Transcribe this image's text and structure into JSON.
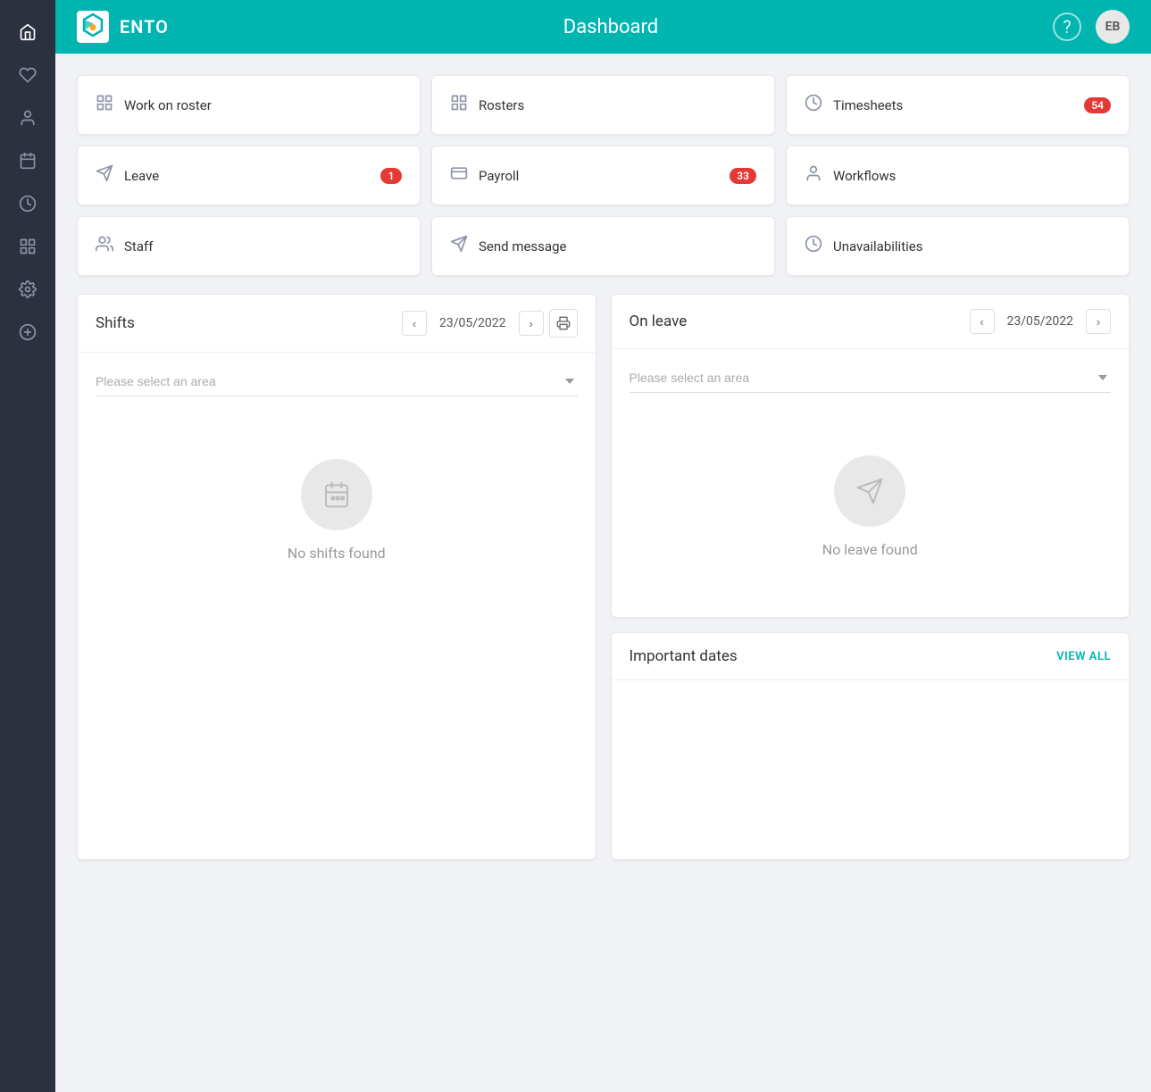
{
  "sidebar": {
    "icons": [
      {
        "name": "home-icon",
        "symbol": "⌂"
      },
      {
        "name": "heart-icon",
        "symbol": "♡"
      },
      {
        "name": "person-icon",
        "symbol": "👤"
      },
      {
        "name": "calendar-icon",
        "symbol": "▦"
      },
      {
        "name": "clock-icon",
        "symbol": "🕐"
      },
      {
        "name": "grid-icon",
        "symbol": "⊞"
      },
      {
        "name": "settings-icon",
        "symbol": "⚙"
      },
      {
        "name": "add-circle-icon",
        "symbol": "⊕"
      }
    ]
  },
  "header": {
    "title": "Dashboard",
    "help_label": "?",
    "avatar_initials": "EB"
  },
  "quick_links": [
    {
      "id": "work-on-roster",
      "label": "Work on roster",
      "badge": null,
      "icon": "roster-icon"
    },
    {
      "id": "rosters",
      "label": "Rosters",
      "badge": null,
      "icon": "roster-icon"
    },
    {
      "id": "timesheets",
      "label": "Timesheets",
      "badge": "54",
      "icon": "clock-icon"
    },
    {
      "id": "leave",
      "label": "Leave",
      "badge": "1",
      "icon": "leave-icon"
    },
    {
      "id": "payroll",
      "label": "Payroll",
      "badge": "33",
      "icon": "payroll-icon"
    },
    {
      "id": "workflows",
      "label": "Workflows",
      "badge": null,
      "icon": "workflows-icon"
    },
    {
      "id": "staff",
      "label": "Staff",
      "badge": null,
      "icon": "staff-icon"
    },
    {
      "id": "send-message",
      "label": "Send message",
      "badge": null,
      "icon": "message-icon"
    },
    {
      "id": "unavailabilities",
      "label": "Unavailabilities",
      "badge": null,
      "icon": "unavail-icon"
    }
  ],
  "shifts_panel": {
    "title": "Shifts",
    "date": "23/05/2022",
    "area_placeholder": "Please select an area",
    "empty_text": "No shifts found"
  },
  "on_leave_panel": {
    "title": "On leave",
    "date": "23/05/2022",
    "area_placeholder": "Please select an area",
    "empty_text": "No leave found"
  },
  "important_dates_panel": {
    "title": "Important dates",
    "view_all_label": "VIEW ALL"
  },
  "colors": {
    "teal": "#00b5b0",
    "dark_sidebar": "#2c3140",
    "badge_red": "#e53935"
  }
}
